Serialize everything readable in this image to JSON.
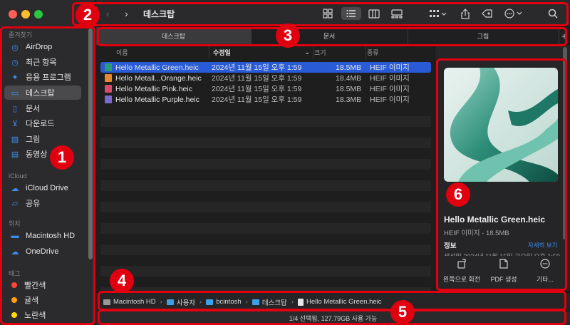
{
  "sidebar": {
    "sections": [
      {
        "header": "즐겨찾기",
        "items": [
          {
            "label": "AirDrop",
            "icon": "airdrop-icon"
          },
          {
            "label": "최근 항목",
            "icon": "clock-icon"
          },
          {
            "label": "응용 프로그램",
            "icon": "apps-icon"
          },
          {
            "label": "데스크탑",
            "icon": "desktop-icon",
            "active": true
          },
          {
            "label": "문서",
            "icon": "document-icon"
          },
          {
            "label": "다운로드",
            "icon": "download-icon"
          },
          {
            "label": "그림",
            "icon": "picture-icon"
          },
          {
            "label": "동영상",
            "icon": "movie-icon"
          }
        ]
      },
      {
        "header": "iCloud",
        "items": [
          {
            "label": "iCloud Drive",
            "icon": "cloud-icon"
          },
          {
            "label": "공유",
            "icon": "shared-folder-icon"
          }
        ]
      },
      {
        "header": "위치",
        "items": [
          {
            "label": "Macintosh HD",
            "icon": "disk-icon"
          },
          {
            "label": "OneDrive",
            "icon": "cloud-icon"
          }
        ]
      },
      {
        "header": "태그",
        "items": [
          {
            "label": "빨간색",
            "color": "#ff453a"
          },
          {
            "label": "귤색",
            "color": "#ff9f0a"
          },
          {
            "label": "노란색",
            "color": "#ffd60a"
          }
        ]
      }
    ]
  },
  "toolbar": {
    "title": "데스크탑"
  },
  "tabs": [
    {
      "label": "데스크탑",
      "active": true
    },
    {
      "label": "문서",
      "active": false
    },
    {
      "label": "그림",
      "active": false
    }
  ],
  "columns": [
    "이름",
    "수정일",
    "크기",
    "종류"
  ],
  "files": [
    {
      "name": "Hello Metallic Green.heic",
      "date": "2024년 11월 15일 오후 1:59",
      "size": "18.5MB",
      "kind": "HEIF 이미지",
      "selected": true,
      "color": "#2f9a79"
    },
    {
      "name": "Hello Metall...Orange.heic",
      "date": "2024년 11월 15일 오후 1:59",
      "size": "18.4MB",
      "kind": "HEIF 이미지",
      "selected": false,
      "color": "#e8892f"
    },
    {
      "name": "Hello Metallic Pink.heic",
      "date": "2024년 11월 15일 오후 1:59",
      "size": "18.5MB",
      "kind": "HEIF 이미지",
      "selected": false,
      "color": "#d84a6a"
    },
    {
      "name": "Hello Metallic Purple.heic",
      "date": "2024년 11월 15일 오후 1:59",
      "size": "18.3MB",
      "kind": "HEIF 이미지",
      "selected": false,
      "color": "#7a6ad0"
    }
  ],
  "preview": {
    "filename": "Hello Metallic Green.heic",
    "subtitle": "HEIF 이미지 - 18.5MB",
    "info_label": "정보",
    "more_link": "자세히 보기",
    "info_row": "생성일   2024년 11월 15일 금요일 오후 1:59",
    "actions": [
      {
        "label": "왼쪽으로 회전",
        "icon": "rotate-left-icon"
      },
      {
        "label": "PDF 생성",
        "icon": "pdf-icon"
      },
      {
        "label": "기타...",
        "icon": "more-icon"
      }
    ]
  },
  "pathbar": [
    "Macintosh HD",
    "사용자",
    "bcintosh",
    "데스크탑",
    "Hello Metallic Green.heic"
  ],
  "status": "1/4 선택됨, 127.79GB 사용 가능",
  "annotations": [
    "1",
    "2",
    "3",
    "4",
    "5",
    "6"
  ]
}
